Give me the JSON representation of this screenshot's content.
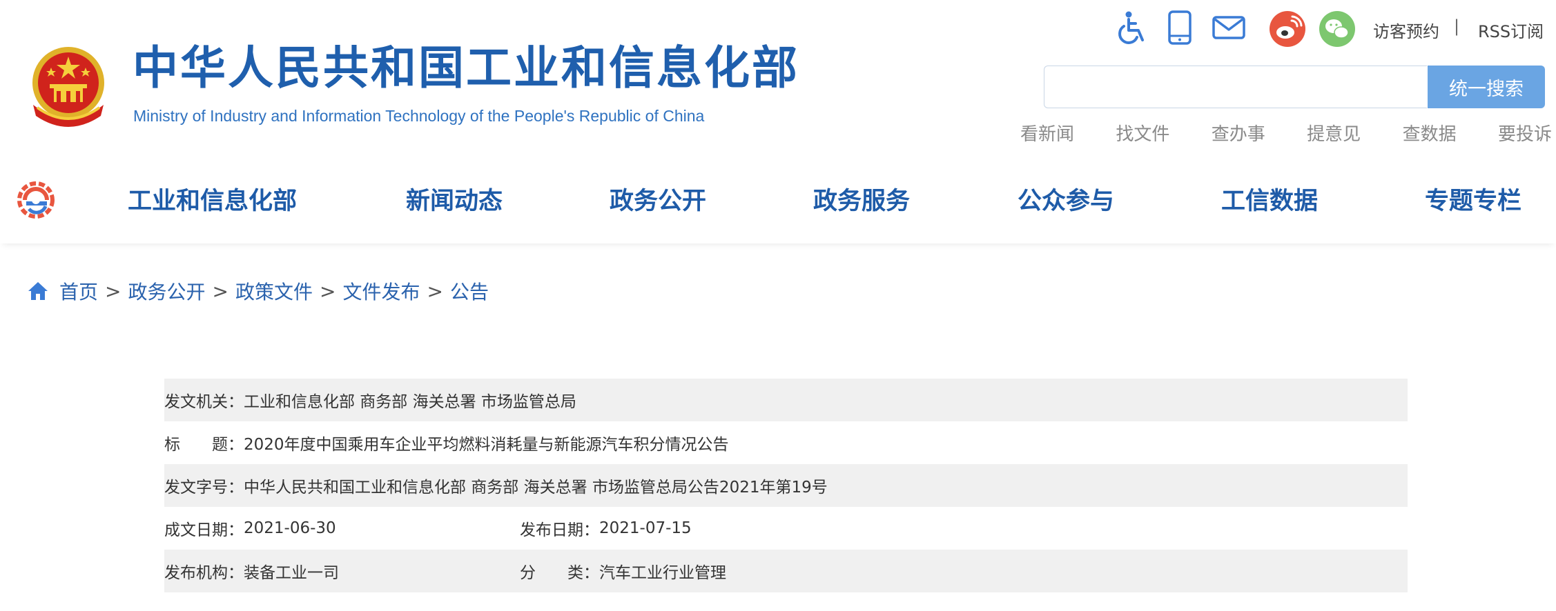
{
  "header": {
    "title": "中华人民共和国工业和信息化部",
    "subtitle": "Ministry of Industry and Information Technology of the People's Republic of China",
    "icons": [
      "accessibility-icon",
      "mobile-icon",
      "mail-icon",
      "weibo-icon",
      "wechat-icon"
    ],
    "visitor_link": "访客预约",
    "separator": "|",
    "rss_link": "RSS订阅",
    "search": {
      "placeholder": "",
      "button_label": "统一搜索"
    },
    "quick_links": [
      "看新闻",
      "找文件",
      "查办事",
      "提意见",
      "查数据",
      "要投诉"
    ]
  },
  "nav": {
    "logo_icon": "miit-logo-icon",
    "items": [
      "工业和信息化部",
      "新闻动态",
      "政务公开",
      "政务服务",
      "公众参与",
      "工信数据",
      "专题专栏"
    ]
  },
  "breadcrumb": {
    "icon": "home-icon",
    "items": [
      "首页",
      "政务公开",
      "政策文件",
      "文件发布",
      "公告"
    ],
    "separator": ">"
  },
  "info": {
    "issuing_org": {
      "label": "发文机关：",
      "value": "工业和信息化部 商务部 海关总署 市场监管总局"
    },
    "title": {
      "label": "标　　题：",
      "value": "2020年度中国乘用车企业平均燃料消耗量与新能源汽车积分情况公告"
    },
    "doc_number": {
      "label": "发文字号：",
      "value": "中华人民共和国工业和信息化部 商务部 海关总署 市场监管总局公告2021年第19号"
    },
    "created_date": {
      "label": "成文日期：",
      "value": "2021-06-30"
    },
    "publish_date": {
      "label": "发布日期：",
      "value": "2021-07-15"
    },
    "publishing_org": {
      "label": "发布机构：",
      "value": "装备工业一司"
    },
    "category": {
      "label": "分　　类：",
      "value": "汽车工业行业管理"
    }
  },
  "colors": {
    "brand_blue": "#1f5fad",
    "search_button": "#6aa5e3",
    "weibo_red": "#e8563f",
    "wechat_green": "#7dc76f",
    "row_shade": "#f0f0f0"
  }
}
